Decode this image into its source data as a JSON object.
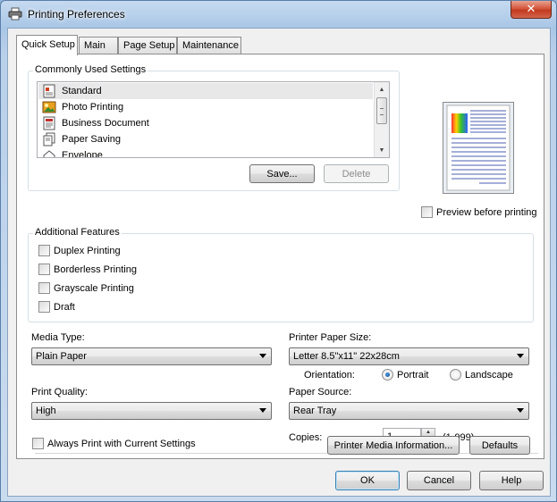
{
  "window": {
    "title": "Printing Preferences",
    "close_label": "✕"
  },
  "tabs": [
    {
      "label": "Quick Setup",
      "active": true
    },
    {
      "label": "Main",
      "active": false
    },
    {
      "label": "Page Setup",
      "active": false
    },
    {
      "label": "Maintenance",
      "active": false
    }
  ],
  "commonly_used": {
    "group_label": "Commonly Used Settings",
    "items": [
      {
        "label": "Standard",
        "icon": "standard-doc-icon",
        "selected": true
      },
      {
        "label": "Photo Printing",
        "icon": "photo-icon",
        "selected": false
      },
      {
        "label": "Business Document",
        "icon": "business-doc-icon",
        "selected": false
      },
      {
        "label": "Paper Saving",
        "icon": "paper-saving-icon",
        "selected": false
      },
      {
        "label": "Envelope",
        "icon": "envelope-icon",
        "selected": false
      }
    ],
    "save_label": "Save...",
    "delete_label": "Delete"
  },
  "preview": {
    "checkbox_label": "Preview before printing",
    "checked": false
  },
  "additional_features": {
    "group_label": "Additional Features",
    "items": [
      {
        "label": "Duplex Printing",
        "checked": false
      },
      {
        "label": "Borderless Printing",
        "checked": false
      },
      {
        "label": "Grayscale Printing",
        "checked": false
      },
      {
        "label": "Draft",
        "checked": false
      }
    ]
  },
  "media_type": {
    "label": "Media Type:",
    "value": "Plain Paper"
  },
  "paper_size": {
    "label": "Printer Paper Size:",
    "value": "Letter 8.5\"x11\" 22x28cm"
  },
  "orientation": {
    "label": "Orientation:",
    "options": [
      {
        "label": "Portrait",
        "selected": true
      },
      {
        "label": "Landscape",
        "selected": false
      }
    ]
  },
  "print_quality": {
    "label": "Print Quality:",
    "value": "High"
  },
  "paper_source": {
    "label": "Paper Source:",
    "value": "Rear Tray"
  },
  "copies": {
    "label": "Copies:",
    "value": "1",
    "range": "(1-999)"
  },
  "always_print": {
    "label": "Always Print with Current Settings",
    "checked": false
  },
  "buttons": {
    "media_info": "Printer Media Information...",
    "defaults": "Defaults",
    "ok": "OK",
    "cancel": "Cancel",
    "help": "Help"
  },
  "colors": {
    "accent": "#3c7fb1",
    "title_bar": "#a9c6e6",
    "close_red": "#c23a1f"
  }
}
